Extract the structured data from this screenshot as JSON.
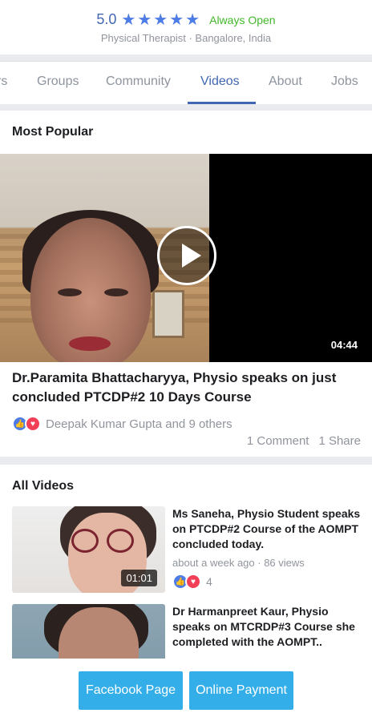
{
  "header": {
    "rating": "5.0",
    "star_count": 5,
    "status": "Always Open",
    "subtitle": "Physical Therapist · Bangalore, India"
  },
  "tabs": [
    {
      "label": "rs"
    },
    {
      "label": "Groups"
    },
    {
      "label": "Community"
    },
    {
      "label": "Videos",
      "active": true
    },
    {
      "label": "About"
    },
    {
      "label": "Jobs"
    }
  ],
  "most_popular": {
    "title": "Most Popular",
    "video": {
      "duration": "04:44",
      "title": "Dr.Paramita Bhattacharyya, Physio speaks on just concluded PTCDP#2 10 Days Course",
      "reactions_text": "Deepak Kumar Gupta and 9 others",
      "comments": "1 Comment",
      "shares": "1 Share"
    }
  },
  "all_videos": {
    "title": "All Videos",
    "items": [
      {
        "title": "Ms Saneha, Physio Student speaks on PTCDP#2 Course of the AOMPT concluded today.",
        "meta": "about a week ago · 86 views",
        "duration": "01:01",
        "reaction_count": "4"
      },
      {
        "title": "Dr Harmanpreet Kaur, Physio speaks on MTCRDP#3 Course she completed with the AOMPT..",
        "meta": "",
        "duration": "",
        "reaction_count": ""
      }
    ]
  },
  "buttons": {
    "facebook_page": "Facebook Page",
    "online_payment": "Online Payment"
  },
  "colors": {
    "accent": "#4267b2",
    "open_green": "#42b72a",
    "button_blue": "#34aee8",
    "like_blue": "#4e7ce6",
    "love_red": "#f33e58"
  }
}
